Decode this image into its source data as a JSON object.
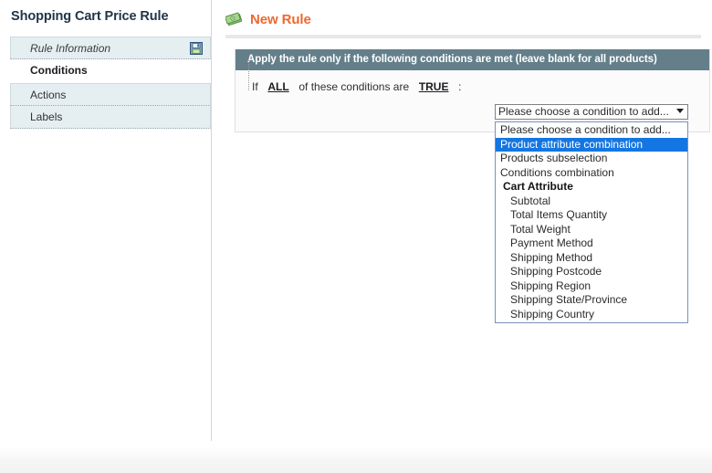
{
  "sidebar": {
    "title": "Shopping Cart Price Rule",
    "items": [
      {
        "label": "Rule Information",
        "icon": "save-icon"
      },
      {
        "label": "Conditions"
      },
      {
        "label": "Actions"
      },
      {
        "label": "Labels"
      }
    ]
  },
  "content": {
    "icon": "money-banknote-icon",
    "title": "New Rule",
    "panel": {
      "header": "Apply the rule only if the following conditions are met (leave blank for all products)",
      "logic": {
        "prefix": "If",
        "aggregator": "ALL",
        "middle": "of these conditions are",
        "value": "TRUE",
        "suffix": ":"
      }
    },
    "condition_select": {
      "selected": "Please choose a condition to add...",
      "arrow_icon": "chevron-down-icon",
      "options": [
        {
          "label": "Please choose a condition to add...",
          "type": "option",
          "selected": false
        },
        {
          "label": "Product attribute combination",
          "type": "option",
          "selected": true
        },
        {
          "label": "Products subselection",
          "type": "option",
          "selected": false
        },
        {
          "label": "Conditions combination",
          "type": "option",
          "selected": false
        },
        {
          "label": "Cart Attribute",
          "type": "group",
          "selected": false
        },
        {
          "label": "Subtotal",
          "type": "option-indent",
          "selected": false
        },
        {
          "label": "Total Items Quantity",
          "type": "option-indent",
          "selected": false
        },
        {
          "label": "Total Weight",
          "type": "option-indent",
          "selected": false
        },
        {
          "label": "Payment Method",
          "type": "option-indent",
          "selected": false
        },
        {
          "label": "Shipping Method",
          "type": "option-indent",
          "selected": false
        },
        {
          "label": "Shipping Postcode",
          "type": "option-indent",
          "selected": false
        },
        {
          "label": "Shipping Region",
          "type": "option-indent",
          "selected": false
        },
        {
          "label": "Shipping State/Province",
          "type": "option-indent",
          "selected": false
        },
        {
          "label": "Shipping Country",
          "type": "option-indent",
          "selected": false
        }
      ]
    }
  },
  "colors": {
    "accent_title": "#ef672f",
    "panel_header_bg": "#647f8a",
    "select_highlight": "#1476e2",
    "sidebar_item_bg": "#e5eef0"
  }
}
